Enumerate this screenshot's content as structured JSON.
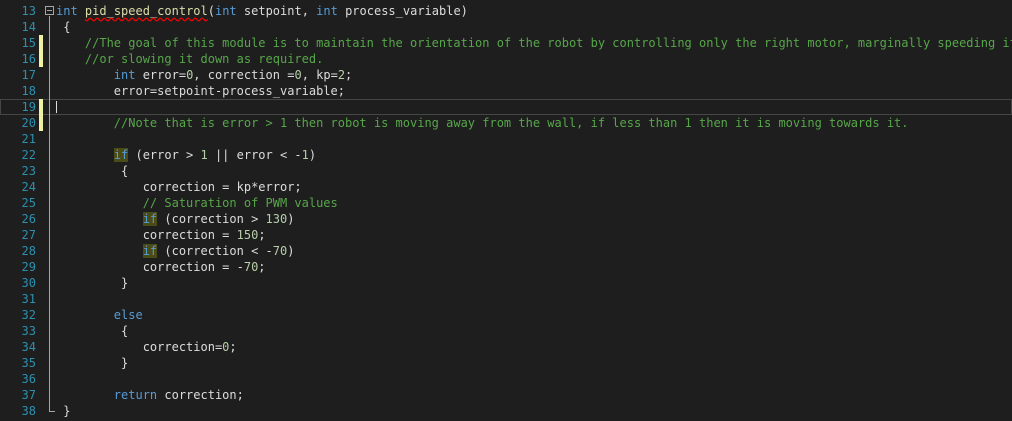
{
  "editor": {
    "lines": [
      {
        "num": "13",
        "changed": false,
        "fold": true,
        "segs": [
          {
            "t": "int",
            "c": "kw"
          },
          {
            "t": " "
          },
          {
            "t": "pid_speed_control",
            "c": "fn"
          },
          {
            "t": "("
          },
          {
            "t": "int",
            "c": "kw"
          },
          {
            "t": " setpoint, "
          },
          {
            "t": "int",
            "c": "kw"
          },
          {
            "t": " process_variable)"
          }
        ]
      },
      {
        "num": "14",
        "changed": false,
        "segs": [
          {
            "t": " {"
          }
        ]
      },
      {
        "num": "15",
        "changed": true,
        "segs": [
          {
            "t": "    //The goal of this module is to maintain the orientation of the robot by controlling only the right motor, marginally speeding it up",
            "c": "cm"
          }
        ]
      },
      {
        "num": "16",
        "changed": true,
        "segs": [
          {
            "t": "    //or slowing it down as required.",
            "c": "cm"
          }
        ]
      },
      {
        "num": "17",
        "changed": false,
        "segs": [
          {
            "t": "        "
          },
          {
            "t": "int",
            "c": "kw"
          },
          {
            "t": " error="
          },
          {
            "t": "0",
            "c": "num"
          },
          {
            "t": ", correction ="
          },
          {
            "t": "0",
            "c": "num"
          },
          {
            "t": ", kp="
          },
          {
            "t": "2",
            "c": "num"
          },
          {
            "t": ";"
          }
        ]
      },
      {
        "num": "18",
        "changed": false,
        "segs": [
          {
            "t": "        error=setpoint-process_variable;"
          }
        ]
      },
      {
        "num": "19",
        "changed": true,
        "current": true,
        "segs": [
          {
            "t": ""
          }
        ]
      },
      {
        "num": "20",
        "changed": true,
        "segs": [
          {
            "t": "        //Note that is error > 1 then robot is moving away from the wall, if less than 1 then it is moving towards it.",
            "c": "cm"
          }
        ]
      },
      {
        "num": "21",
        "changed": false,
        "segs": [
          {
            "t": ""
          }
        ]
      },
      {
        "num": "22",
        "changed": false,
        "segs": [
          {
            "t": "        "
          },
          {
            "t": "if",
            "c": "kw hl"
          },
          {
            "t": " (error > "
          },
          {
            "t": "1",
            "c": "num"
          },
          {
            "t": " || error < -"
          },
          {
            "t": "1",
            "c": "num"
          },
          {
            "t": ")"
          }
        ]
      },
      {
        "num": "23",
        "changed": false,
        "segs": [
          {
            "t": "         {"
          }
        ]
      },
      {
        "num": "24",
        "changed": false,
        "segs": [
          {
            "t": "            correction = kp*error;"
          }
        ]
      },
      {
        "num": "25",
        "changed": false,
        "segs": [
          {
            "t": "            // Saturation of PWM values",
            "c": "cm"
          }
        ]
      },
      {
        "num": "26",
        "changed": false,
        "segs": [
          {
            "t": "            "
          },
          {
            "t": "if",
            "c": "kw hl"
          },
          {
            "t": " (correction > "
          },
          {
            "t": "130",
            "c": "num"
          },
          {
            "t": ")"
          }
        ]
      },
      {
        "num": "27",
        "changed": false,
        "segs": [
          {
            "t": "            correction = "
          },
          {
            "t": "150",
            "c": "num"
          },
          {
            "t": ";"
          }
        ]
      },
      {
        "num": "28",
        "changed": false,
        "segs": [
          {
            "t": "            "
          },
          {
            "t": "if",
            "c": "kw hl"
          },
          {
            "t": " (correction < -"
          },
          {
            "t": "70",
            "c": "num"
          },
          {
            "t": ")"
          }
        ]
      },
      {
        "num": "29",
        "changed": false,
        "segs": [
          {
            "t": "            correction = -"
          },
          {
            "t": "70",
            "c": "num"
          },
          {
            "t": ";"
          }
        ]
      },
      {
        "num": "30",
        "changed": false,
        "segs": [
          {
            "t": "         }"
          }
        ]
      },
      {
        "num": "31",
        "changed": false,
        "segs": [
          {
            "t": ""
          }
        ]
      },
      {
        "num": "32",
        "changed": false,
        "segs": [
          {
            "t": "        "
          },
          {
            "t": "else",
            "c": "kw"
          }
        ]
      },
      {
        "num": "33",
        "changed": false,
        "segs": [
          {
            "t": "         {"
          }
        ]
      },
      {
        "num": "34",
        "changed": false,
        "segs": [
          {
            "t": "            correction="
          },
          {
            "t": "0",
            "c": "num"
          },
          {
            "t": ";"
          }
        ]
      },
      {
        "num": "35",
        "changed": false,
        "segs": [
          {
            "t": "         }"
          }
        ]
      },
      {
        "num": "36",
        "changed": false,
        "segs": [
          {
            "t": ""
          }
        ]
      },
      {
        "num": "37",
        "changed": false,
        "segs": [
          {
            "t": "        "
          },
          {
            "t": "return",
            "c": "kw"
          },
          {
            "t": " correction;"
          }
        ]
      },
      {
        "num": "38",
        "changed": false,
        "segs": [
          {
            "t": " }"
          }
        ]
      }
    ]
  },
  "colors": {
    "background": "#1e1e1e",
    "line_number": "#2b91af",
    "keyword": "#569cd6",
    "comment": "#57a64a",
    "number": "#b5cea8",
    "change_marker": "#eff2a3"
  }
}
